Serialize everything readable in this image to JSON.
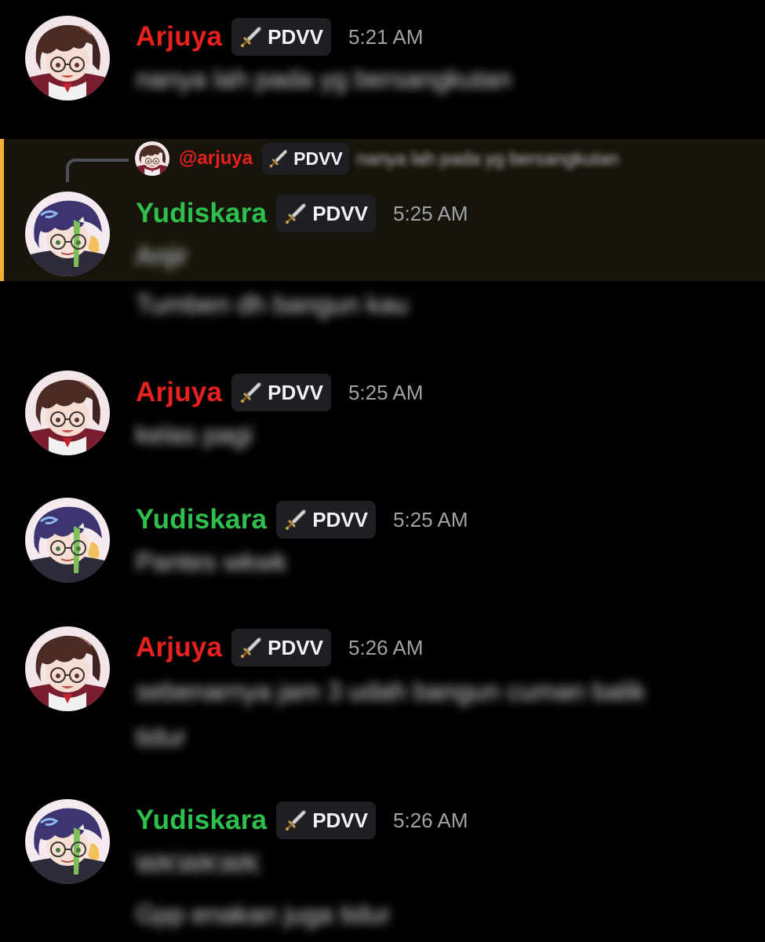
{
  "colors": {
    "background": "#000000",
    "arjuya_name": "#e8211f",
    "yudiskara_name": "#2ec04d",
    "reply_highlight": "#17140b",
    "reply_accent": "#f0b232",
    "tag_bg": "#1e1f22",
    "timestamp": "#9fa3a8"
  },
  "tag_icon": "sword-icon",
  "messages": [
    {
      "author": "Arjuya",
      "avatar_icon": "arjuya-avatar",
      "tag": "PDVV",
      "time": "5:21 AM",
      "lines": [
        "nanya lah pada yg bersangkutan"
      ]
    },
    {
      "author": "Yudiskara",
      "avatar_icon": "yudiskara-avatar",
      "tag": "PDVV",
      "time": "5:25 AM",
      "reply": {
        "mention": "@arjuya",
        "tag": "PDVV",
        "preview": "nanya lah pada yg bersangkutan"
      },
      "lines": [
        "Anjir",
        "Tumben dh bangun kau"
      ]
    },
    {
      "author": "Arjuya",
      "avatar_icon": "arjuya-avatar",
      "tag": "PDVV",
      "time": "5:25 AM",
      "lines": [
        "kelas pagi"
      ]
    },
    {
      "author": "Yudiskara",
      "avatar_icon": "yudiskara-avatar",
      "tag": "PDVV",
      "time": "5:25 AM",
      "lines": [
        "Pantes wkwk"
      ]
    },
    {
      "author": "Arjuya",
      "avatar_icon": "arjuya-avatar",
      "tag": "PDVV",
      "time": "5:26 AM",
      "lines": [
        "sebenarnya jam 3 udah bangun cuman balik",
        "tidur"
      ]
    },
    {
      "author": "Yudiskara",
      "avatar_icon": "yudiskara-avatar",
      "tag": "PDVV",
      "time": "5:26 AM",
      "lines": [
        "WKWKWK",
        "Gpp enakan juga tidur"
      ]
    }
  ]
}
